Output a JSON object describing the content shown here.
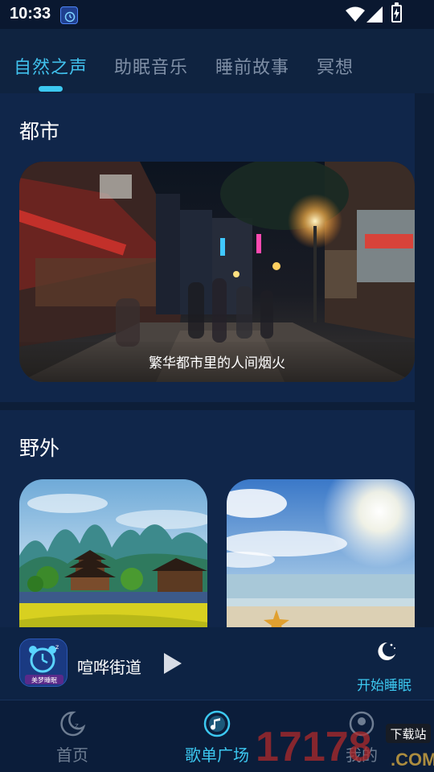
{
  "status_bar": {
    "time": "10:33"
  },
  "tabs": [
    {
      "label": "自然之声",
      "active": true
    },
    {
      "label": "助眠音乐",
      "active": false
    },
    {
      "label": "睡前故事",
      "active": false
    },
    {
      "label": "冥想",
      "active": false
    }
  ],
  "sections": [
    {
      "title": "都市",
      "cards": [
        {
          "caption": "繁华都市里的人间烟火"
        }
      ]
    },
    {
      "title": "野外",
      "cards": [
        {
          "caption": ""
        },
        {
          "caption": ""
        }
      ]
    }
  ],
  "player": {
    "cover_text": "美梦睡眠",
    "title": "喧哗街道",
    "sleep_label": "开始睡眠"
  },
  "bottom_nav": [
    {
      "label": "首页",
      "icon": "moon-icon",
      "active": false
    },
    {
      "label": "歌单广场",
      "icon": "music-disc-icon",
      "active": true
    },
    {
      "label": "我的",
      "icon": "profile-icon",
      "active": false
    }
  ],
  "watermark": {
    "number": "17178",
    "site": "下载站",
    "domain": ".COM"
  },
  "colors": {
    "accent": "#3cc8f0",
    "background": "#0d1e38",
    "tab_inactive": "#7f8fa6"
  }
}
